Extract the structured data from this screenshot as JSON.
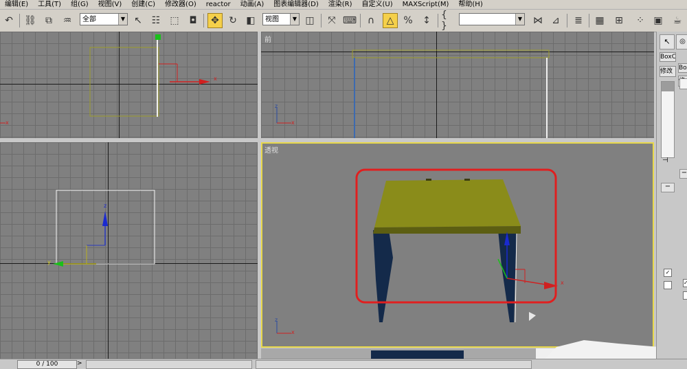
{
  "menu": {
    "items": [
      "编辑(E)",
      "工具(T)",
      "组(G)",
      "视图(V)",
      "创建(C)",
      "修改器(O)",
      "reactor",
      "动画(A)",
      "图表编辑器(D)",
      "渲染(R)",
      "自定义(U)",
      "MAXScript(M)",
      "帮助(H)"
    ]
  },
  "toolbar": {
    "selection_filter": "全部",
    "reference_coord": "视图",
    "named_selection": ""
  },
  "viewports": {
    "front_label": "前",
    "perspective_label": "透视",
    "axis_x": "x",
    "axis_y": "y",
    "axis_z": "z"
  },
  "command_panel": {
    "object_name_1": "BoxC",
    "object_name_2": "Box",
    "modify_tab_1": "修改",
    "modify_tab_2": "修"
  },
  "timebar": {
    "frame_display": "0 / 100"
  },
  "colors": {
    "tabletop": "#8a8c1a",
    "tabletop_shadow": "#5c5e12",
    "leg": "#142a4a",
    "highlight_box": "#e01f1f",
    "active_viewport": "#e8d84a",
    "selection_white": "#ffffff",
    "object_outline": "#9c9c2a"
  }
}
